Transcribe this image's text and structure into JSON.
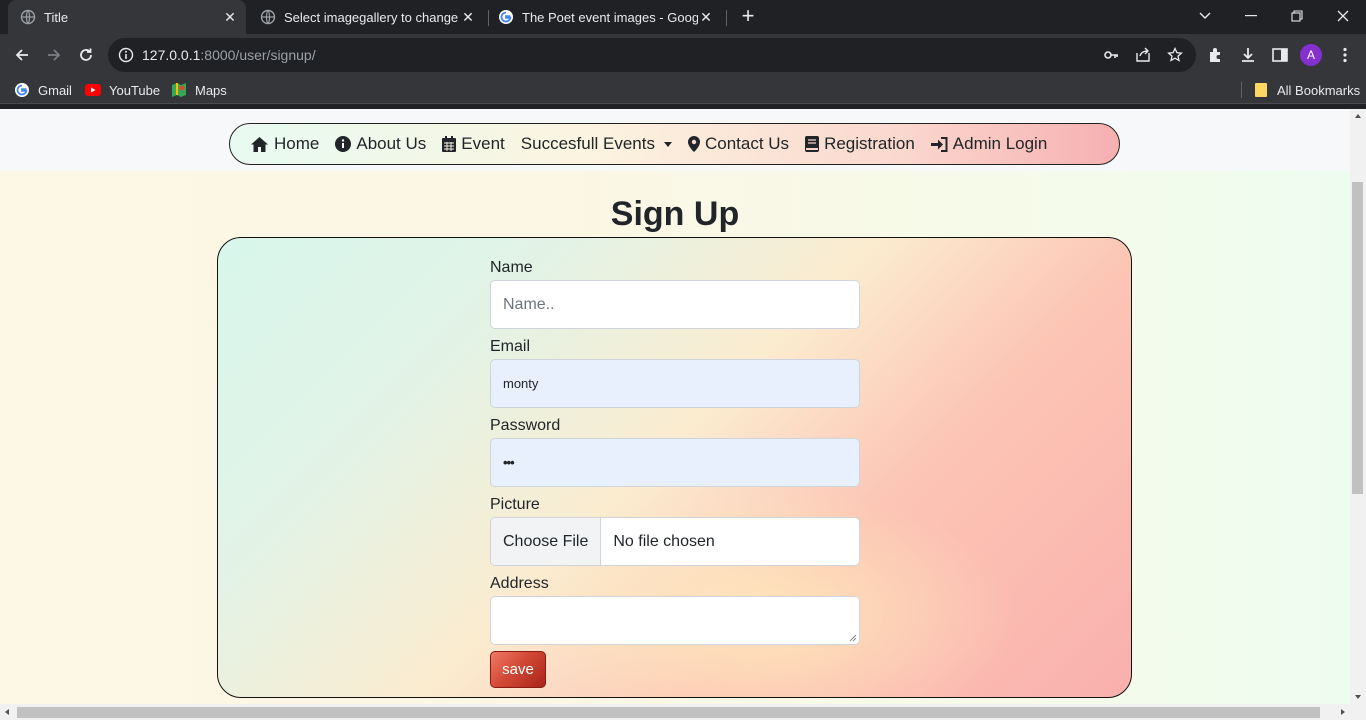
{
  "browser": {
    "tabs": [
      {
        "title": "Title",
        "active": true
      },
      {
        "title": "Select imagegallery to change | D",
        "active": false
      },
      {
        "title": "The Poet event images - Google",
        "active": false
      }
    ],
    "url_host": "127.0.0.1",
    "url_path": ":8000/user/signup/",
    "profile_initial": "A",
    "bookmarks": [
      {
        "label": "Gmail"
      },
      {
        "label": "YouTube"
      },
      {
        "label": "Maps"
      }
    ],
    "all_bookmarks_label": "All Bookmarks"
  },
  "nav": {
    "items": [
      {
        "label": "Home",
        "icon": "home-icon"
      },
      {
        "label": "About Us",
        "icon": "info-icon"
      },
      {
        "label": "Event",
        "icon": "calendar-icon"
      },
      {
        "label": "Succesfull Events",
        "icon": "caret-down-icon"
      },
      {
        "label": "Contact Us",
        "icon": "map-marker-icon"
      },
      {
        "label": "Registration",
        "icon": "book-icon"
      },
      {
        "label": "Admin Login",
        "icon": "sign-in-icon"
      }
    ]
  },
  "page": {
    "title_light": "Sign ",
    "title_bold": "Up"
  },
  "form": {
    "name_label": "Name",
    "name_placeholder": "Name..",
    "email_label": "Email",
    "email_value": "monty",
    "password_label": "Password",
    "password_value": "•••",
    "picture_label": "Picture",
    "choose_file_label": "Choose File",
    "no_file_label": "No file chosen",
    "address_label": "Address",
    "address_value": "",
    "save_label": "save"
  },
  "colors": {
    "save_button": "#c0392b",
    "autofill_bg": "#e8f0fe",
    "chrome_dark": "#202124",
    "chrome_toolbar": "#35363a",
    "avatar": "#8430ce"
  }
}
